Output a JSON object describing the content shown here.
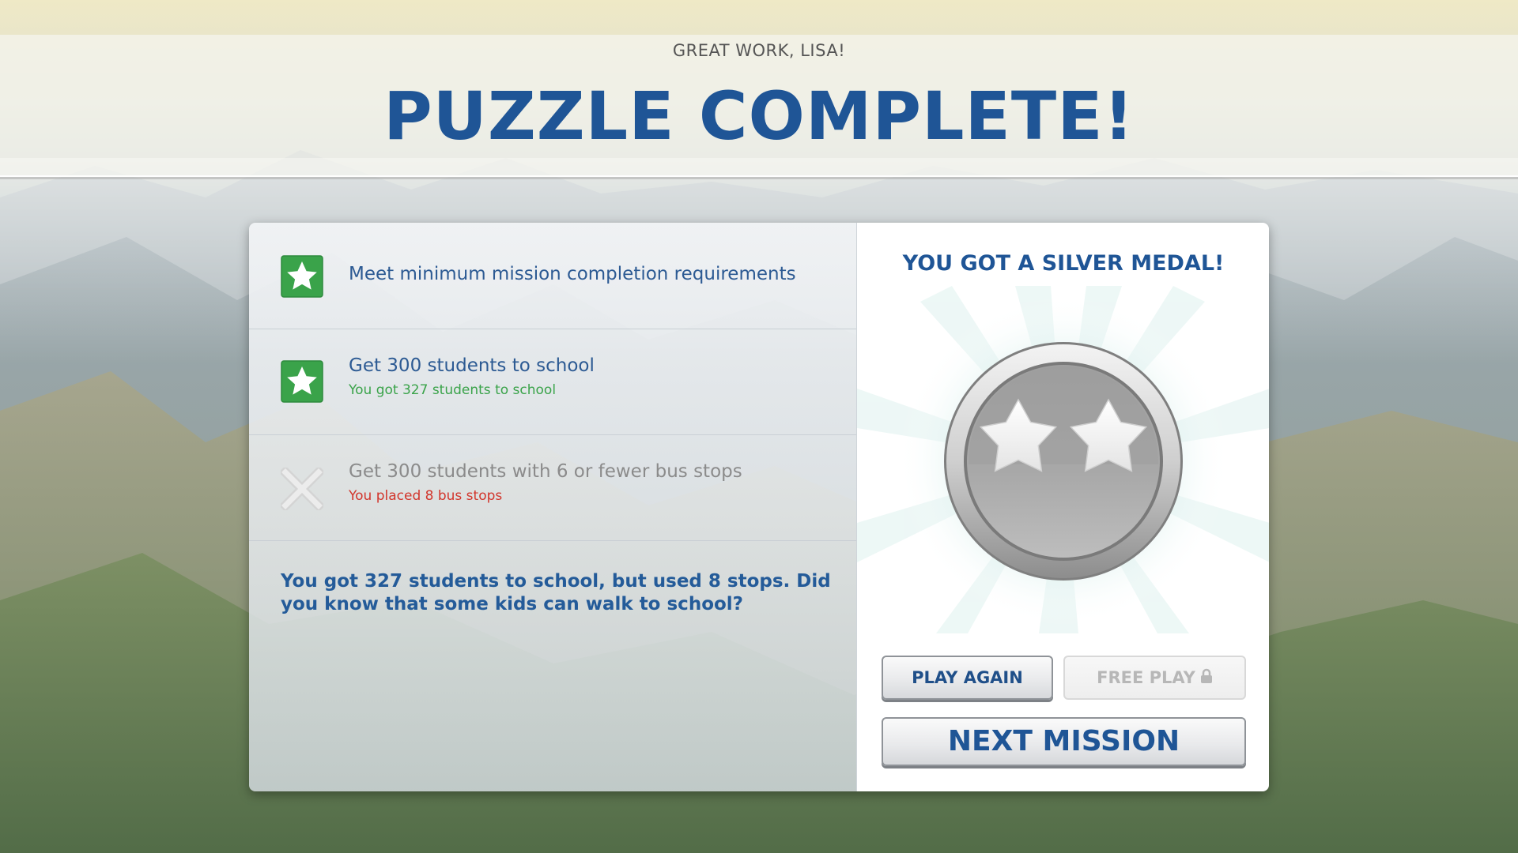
{
  "header": {
    "greeting": "GREAT WORK, LISA!",
    "title": "PUZZLE COMPLETE!"
  },
  "objectives": [
    {
      "status": "complete",
      "icon": "star-icon",
      "title": "Meet minimum mission completion requirements",
      "subtitle": ""
    },
    {
      "status": "complete",
      "icon": "star-icon",
      "title": "Get 300 students to school",
      "subtitle": "You got 327 students to school",
      "subtitle_color": "#3aa34a"
    },
    {
      "status": "failed",
      "icon": "x-icon",
      "title": "Get 300 students with 6 or fewer bus stops",
      "subtitle": "You placed 8 bus stops",
      "subtitle_color": "#d2352b"
    }
  ],
  "feedback": "You got 327 students to school, but used 8 stops. Did you know that some kids can walk to school?",
  "medal": {
    "title": "YOU GOT A SILVER MEDAL!",
    "type": "silver",
    "stars": 2
  },
  "buttons": {
    "play_again": "PLAY AGAIN",
    "free_play": "FREE PLAY",
    "free_play_locked": true,
    "next_mission": "NEXT MISSION"
  },
  "colors": {
    "title_blue": "#1f5596",
    "success_green": "#3aa34a",
    "fail_red": "#d2352b"
  }
}
